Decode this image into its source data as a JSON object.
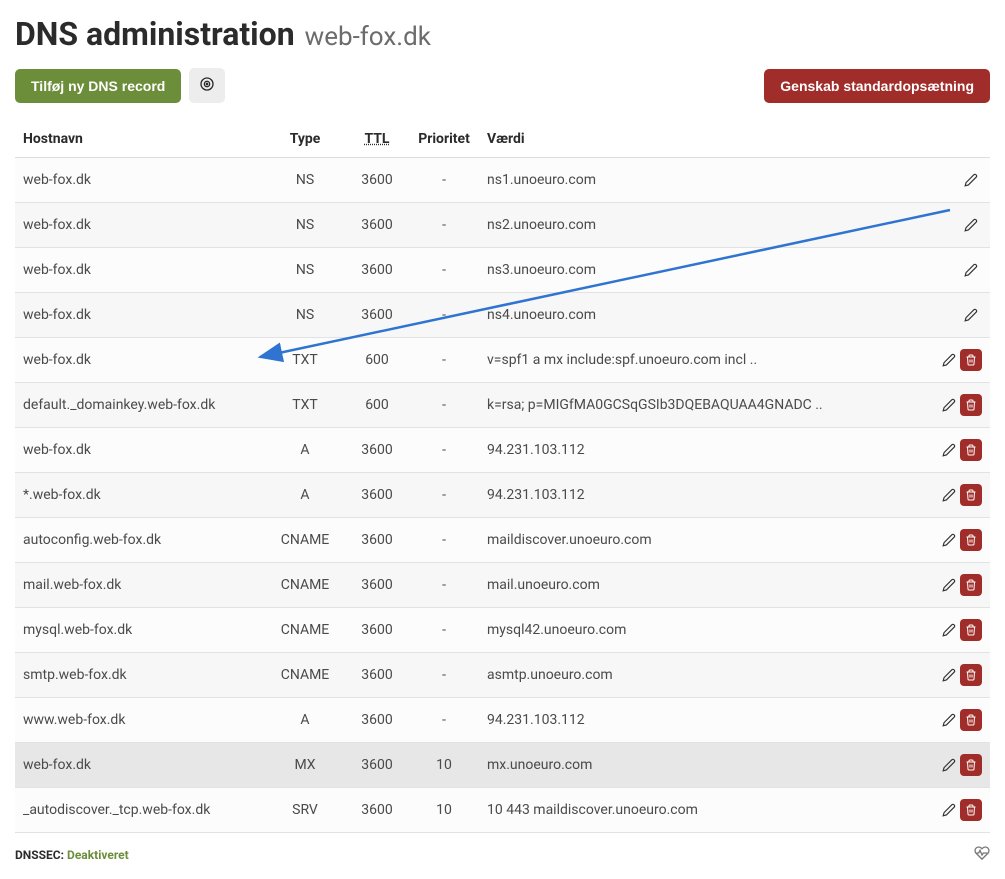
{
  "header": {
    "title": "DNS administration",
    "subtitle": "web-fox.dk"
  },
  "toolbar": {
    "add_label": "Tilføj ny DNS record",
    "reset_label": "Genskab standardopsætning"
  },
  "columns": {
    "host": "Hostnavn",
    "type": "Type",
    "ttl": "TTL",
    "prio": "Prioritet",
    "value": "Værdi"
  },
  "records": [
    {
      "host": "web-fox.dk",
      "type": "NS",
      "ttl": "3600",
      "prio": "-",
      "value": "ns1.unoeuro.com",
      "editable": true,
      "deletable": false
    },
    {
      "host": "web-fox.dk",
      "type": "NS",
      "ttl": "3600",
      "prio": "-",
      "value": "ns2.unoeuro.com",
      "editable": true,
      "deletable": false
    },
    {
      "host": "web-fox.dk",
      "type": "NS",
      "ttl": "3600",
      "prio": "-",
      "value": "ns3.unoeuro.com",
      "editable": true,
      "deletable": false
    },
    {
      "host": "web-fox.dk",
      "type": "NS",
      "ttl": "3600",
      "prio": "-",
      "value": "ns4.unoeuro.com",
      "editable": true,
      "deletable": false
    },
    {
      "host": "web-fox.dk",
      "type": "TXT",
      "ttl": "600",
      "prio": "-",
      "value": "v=spf1 a mx include:spf.unoeuro.com incl ..",
      "editable": true,
      "deletable": true
    },
    {
      "host": "default._domainkey.web-fox.dk",
      "type": "TXT",
      "ttl": "600",
      "prio": "-",
      "value": "k=rsa; p=MIGfMA0GCSqGSIb3DQEBAQUAA4GNADC ..",
      "editable": true,
      "deletable": true
    },
    {
      "host": "web-fox.dk",
      "type": "A",
      "ttl": "3600",
      "prio": "-",
      "value": "94.231.103.112",
      "editable": true,
      "deletable": true
    },
    {
      "host": "*.web-fox.dk",
      "type": "A",
      "ttl": "3600",
      "prio": "-",
      "value": "94.231.103.112",
      "editable": true,
      "deletable": true
    },
    {
      "host": "autoconfig.web-fox.dk",
      "type": "CNAME",
      "ttl": "3600",
      "prio": "-",
      "value": "maildiscover.unoeuro.com",
      "editable": true,
      "deletable": true
    },
    {
      "host": "mail.web-fox.dk",
      "type": "CNAME",
      "ttl": "3600",
      "prio": "-",
      "value": "mail.unoeuro.com",
      "editable": true,
      "deletable": true
    },
    {
      "host": "mysql.web-fox.dk",
      "type": "CNAME",
      "ttl": "3600",
      "prio": "-",
      "value": "mysql42.unoeuro.com",
      "editable": true,
      "deletable": true
    },
    {
      "host": "smtp.web-fox.dk",
      "type": "CNAME",
      "ttl": "3600",
      "prio": "-",
      "value": "asmtp.unoeuro.com",
      "editable": true,
      "deletable": true
    },
    {
      "host": "www.web-fox.dk",
      "type": "A",
      "ttl": "3600",
      "prio": "-",
      "value": "94.231.103.112",
      "editable": true,
      "deletable": true
    },
    {
      "host": "web-fox.dk",
      "type": "MX",
      "ttl": "3600",
      "prio": "10",
      "value": "mx.unoeuro.com",
      "editable": true,
      "deletable": true,
      "highlight": true
    },
    {
      "host": "_autodiscover._tcp.web-fox.dk",
      "type": "SRV",
      "ttl": "3600",
      "prio": "10",
      "value": "10 443 maildiscover.unoeuro.com",
      "editable": true,
      "deletable": true
    }
  ],
  "footer": {
    "dnssec_label": "DNSSEC:",
    "dnssec_value": "Deaktiveret"
  }
}
